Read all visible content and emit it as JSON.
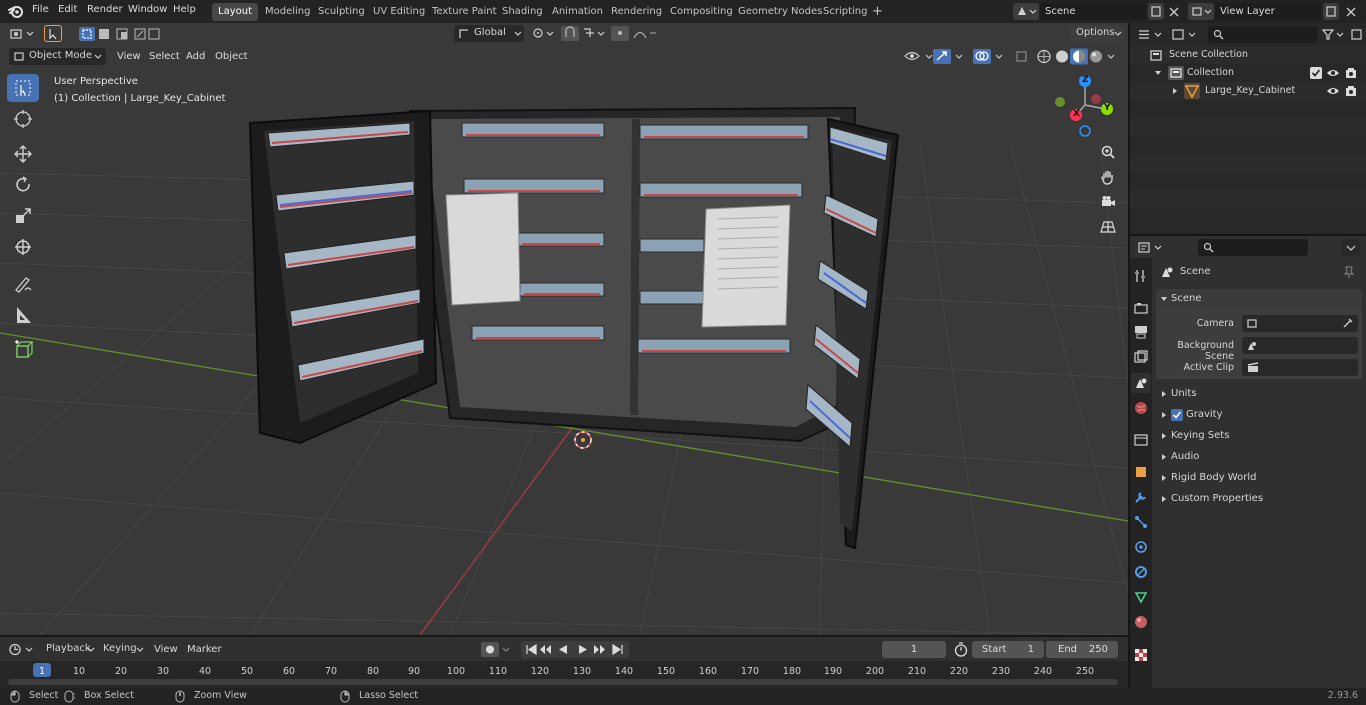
{
  "topbar": {
    "menus": [
      "File",
      "Edit",
      "Render",
      "Window",
      "Help"
    ],
    "workspaces": [
      "Layout",
      "Modeling",
      "Sculpting",
      "UV Editing",
      "Texture Paint",
      "Shading",
      "Animation",
      "Rendering",
      "Compositing",
      "Geometry Nodes",
      "Scripting"
    ],
    "active_workspace": "Layout",
    "add_tab": "+",
    "scene_name": "Scene",
    "view_layer": "View Layer"
  },
  "viewport_header": {
    "mode": "Object Mode",
    "menus": [
      "View",
      "Select",
      "Add",
      "Object"
    ],
    "transform_orientation": "Global",
    "options": "Options"
  },
  "viewport": {
    "perspective": "User Perspective",
    "collection_info": "(1) Collection | Large_Key_Cabinet",
    "gizmo_axes": {
      "x": "X",
      "y": "Y",
      "z": "Z"
    }
  },
  "outliner": {
    "scene_collection": "Scene Collection",
    "collection": "Collection",
    "object": "Large_Key_Cabinet"
  },
  "properties": {
    "header": "Scene",
    "panel_title": "Scene",
    "camera_label": "Camera",
    "background_scene_label": "Background Scene",
    "active_clip_label": "Active Clip",
    "panels": [
      "Units",
      "Gravity",
      "Keying Sets",
      "Audio",
      "Rigid Body World",
      "Custom Properties"
    ]
  },
  "timeline": {
    "menus": [
      "Playback",
      "Keying",
      "View",
      "Marker"
    ],
    "current_frame": "1",
    "start_label": "Start",
    "start_value": "1",
    "end_label": "End",
    "end_value": "250",
    "ticks": [
      "1",
      "10",
      "20",
      "30",
      "40",
      "50",
      "60",
      "70",
      "80",
      "90",
      "100",
      "110",
      "120",
      "130",
      "140",
      "150",
      "160",
      "170",
      "180",
      "190",
      "200",
      "210",
      "220",
      "230",
      "240",
      "250"
    ]
  },
  "statusbar": {
    "select": "Select",
    "box_select": "Box Select",
    "zoom_view": "Zoom View",
    "lasso_select": "Lasso Select",
    "version": "2.93.6"
  },
  "colors": {
    "accent": "#4772b3",
    "x_axis": "#ff3352",
    "y_axis": "#8bdc00",
    "z_axis": "#2890ff",
    "object_orange": "#e8a040"
  }
}
